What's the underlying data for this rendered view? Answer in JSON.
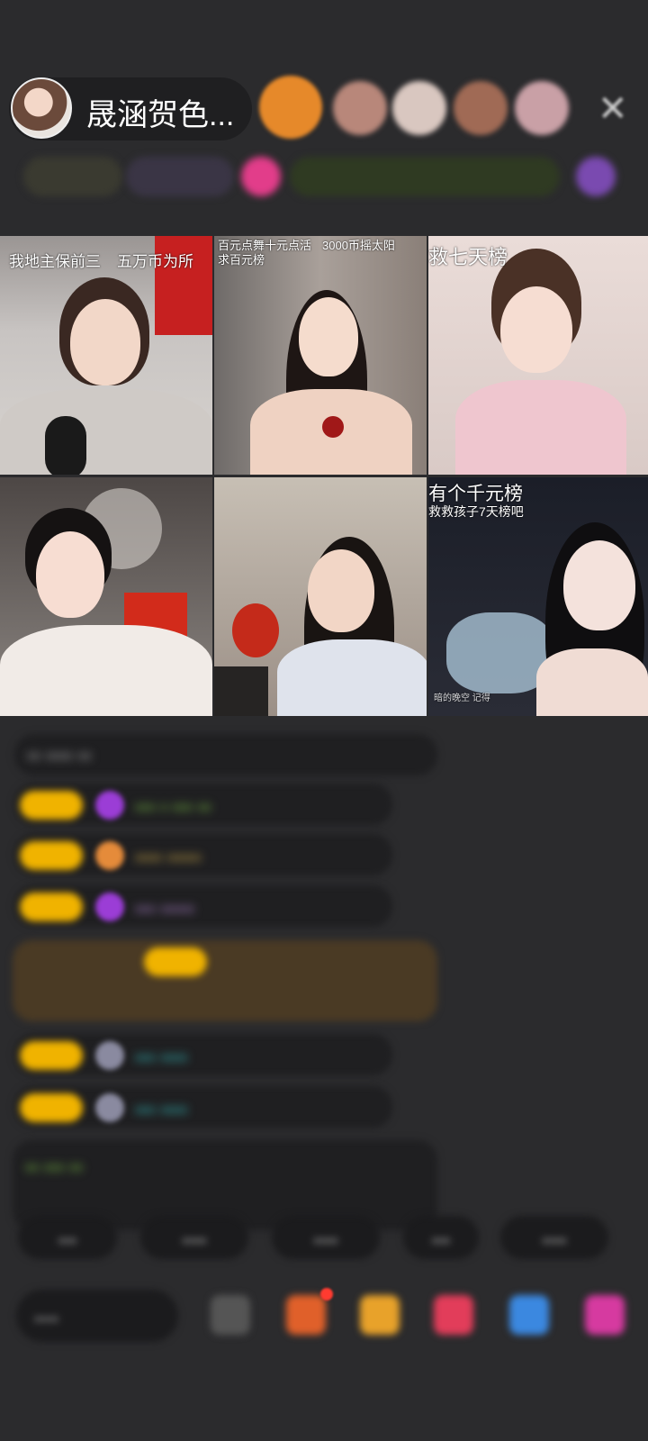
{
  "header": {
    "host_name": "晟涵贺色...",
    "viewers": [
      {
        "color": "#e6892a"
      },
      {
        "color": "#b8877a"
      },
      {
        "color": "#d9c7c0"
      },
      {
        "color": "#a06a55"
      },
      {
        "color": "#c9a0a6"
      }
    ],
    "close_icon": "close-icon",
    "close_glyph": "✕"
  },
  "grid": {
    "tiles": [
      {
        "captions": [
          "我地主保前三",
          "五万币为所"
        ],
        "small": []
      },
      {
        "captions": [],
        "small": [
          "百元点舞十元点活",
          "3000币摇太阳",
          "求百元榜"
        ]
      },
      {
        "captions": [
          "救七天榜"
        ],
        "small": []
      },
      {
        "captions": [],
        "small": []
      },
      {
        "captions": [],
        "small": []
      },
      {
        "captions": [
          "有个千元榜"
        ],
        "small": [
          "救救孩子7天榜吧",
          "暗的晚空 记得"
        ]
      }
    ]
  },
  "chat": {
    "messages": [
      {
        "text": "ₒₒ ₒₒₒₒ ₒₒ"
      },
      {
        "text": "ₒₒₒ ₒ ₒₒₒ ₒₒ"
      },
      {
        "text": "ₒₒₒₒ ₒₒₒₒₒ"
      },
      {
        "text": "ₒₒₒ ₒₒₒₒₒ"
      },
      {
        "text": "ₒₒₒ ₒₒₒₒ"
      },
      {
        "text": "ₒₒₒ ₒₒₒₒ"
      },
      {
        "text": "ₒₒ ₒₒₒ ₒₒ"
      }
    ]
  },
  "bottom": {
    "chips": [
      "ₒₒₒ",
      "ₒₒₒₒ",
      "ₒₒₒₒ",
      "ₒₒₒ",
      "ₒₒₒₒ"
    ],
    "input_placeholder": "ₒₒₒₒ"
  },
  "colors": {
    "background": "#2b2b2d",
    "level_badge": "#f0b300",
    "green_text": "#7bc143",
    "cyan_text": "#35c4c4",
    "purple_gem": "#9b3dd6"
  }
}
